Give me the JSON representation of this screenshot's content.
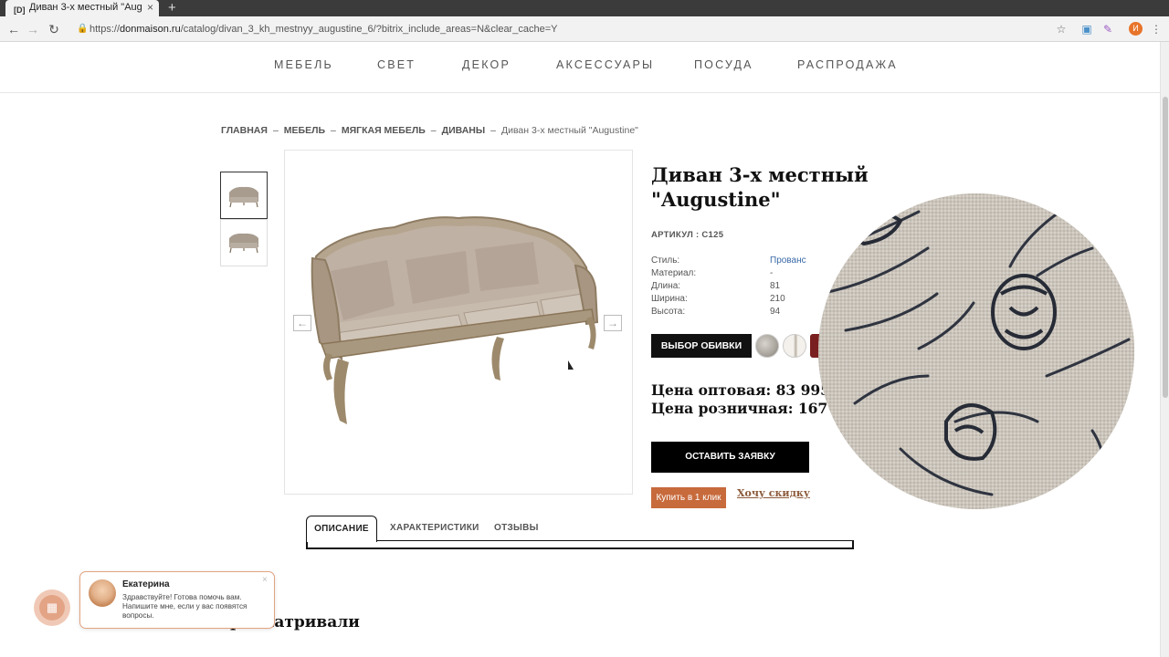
{
  "browser": {
    "tab_title": "Диван 3-х местный \"Aug",
    "tab_favicon": "[D]",
    "tab_close": "×",
    "new_tab": "+",
    "url_scheme": "https://",
    "url_host": "donmaison.ru",
    "url_path": "/catalog/divan_3_kh_mestnyy_augustine_6/?bitrix_include_areas=N&clear_cache=Y",
    "profile_initial": "И"
  },
  "nav": {
    "items": [
      "МЕБЕЛЬ",
      "СВЕТ",
      "ДЕКОР",
      "АКСЕССУАРЫ",
      "ПОСУДА",
      "РАСПРОДАЖА"
    ]
  },
  "breadcrumb": {
    "items": [
      "ГЛАВНАЯ",
      "МЕБЕЛЬ",
      "МЯГКАЯ МЕБЕЛЬ",
      "ДИВАНЫ"
    ],
    "separator": "–",
    "current": "Диван 3-х местный \"Augustine\""
  },
  "product": {
    "title": "Диван 3-х местный \"Augustine\"",
    "sku": "АРТИКУЛ : C125",
    "specs": [
      {
        "label": "Стиль:",
        "value": "Прованс"
      },
      {
        "label": "Материал:",
        "value": "-"
      },
      {
        "label": "Длина:",
        "value": "81"
      },
      {
        "label": "Ширина:",
        "value": "210"
      },
      {
        "label": "Высота:",
        "value": "94"
      }
    ],
    "upholstery_button": "ВЫБОР ОБИВКИ",
    "price_wholesale": "Цена оптовая: 83 995 руб.",
    "price_retail": "Цена розничная: 167 99",
    "request_button": "ОСТАВИТЬ ЗАЯВКУ",
    "one_click_button": "Купить в 1 клик",
    "discount_link": "Хочу скидку"
  },
  "gallery": {
    "prev_arrow": "←",
    "next_arrow": "→"
  },
  "tabs": {
    "items": [
      "ОПИСАНИЕ",
      "ХАРАКТЕРИСТИКИ",
      "ОТЗЫВЫ"
    ],
    "active_index": 0
  },
  "viewed_heading": "росматривали",
  "chat": {
    "agent_name": "Екатерина",
    "message": "Здравствуйте! Готова помочь вам. Напишите мне, если у вас появятся вопросы.",
    "close": "×"
  },
  "colors": {
    "accent_button": "#c76a3c",
    "primary_button": "#000000",
    "link": "#3b6aa8",
    "discount_link": "#8c5a3a"
  }
}
